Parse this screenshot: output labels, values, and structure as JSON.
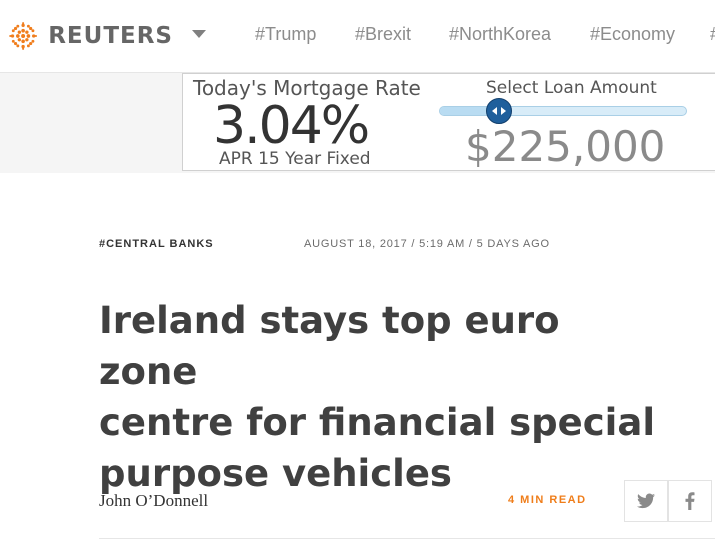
{
  "header": {
    "brand": "REUTERS",
    "nav_tags": [
      "#Trump",
      "#Brexit",
      "#NorthKorea",
      "#Economy",
      "#"
    ]
  },
  "ad": {
    "title": "Today's Mortgage Rate",
    "rate": "3.04%",
    "subtitle": "APR 15 Year Fixed",
    "loan_label": "Select Loan Amount",
    "loan_amount": "$225,000",
    "slider_level": 0.24,
    "colors": {
      "thumb": "#1f5f9c",
      "track": "#d8ecf8"
    }
  },
  "article": {
    "tag": "#CENTRAL BANKS",
    "dateline": "AUGUST 18, 2017 / 5:19 AM / 5 DAYS AGO",
    "headline_lines": [
      "Ireland stays top euro zone",
      "centre for financial special",
      "purpose vehicles"
    ],
    "author": "John O’Donnell",
    "read_time": "4 MIN READ",
    "accent_color": "#ef7d1a"
  },
  "share": {
    "twitter_icon": "twitter-icon",
    "facebook_icon": "facebook-icon"
  }
}
